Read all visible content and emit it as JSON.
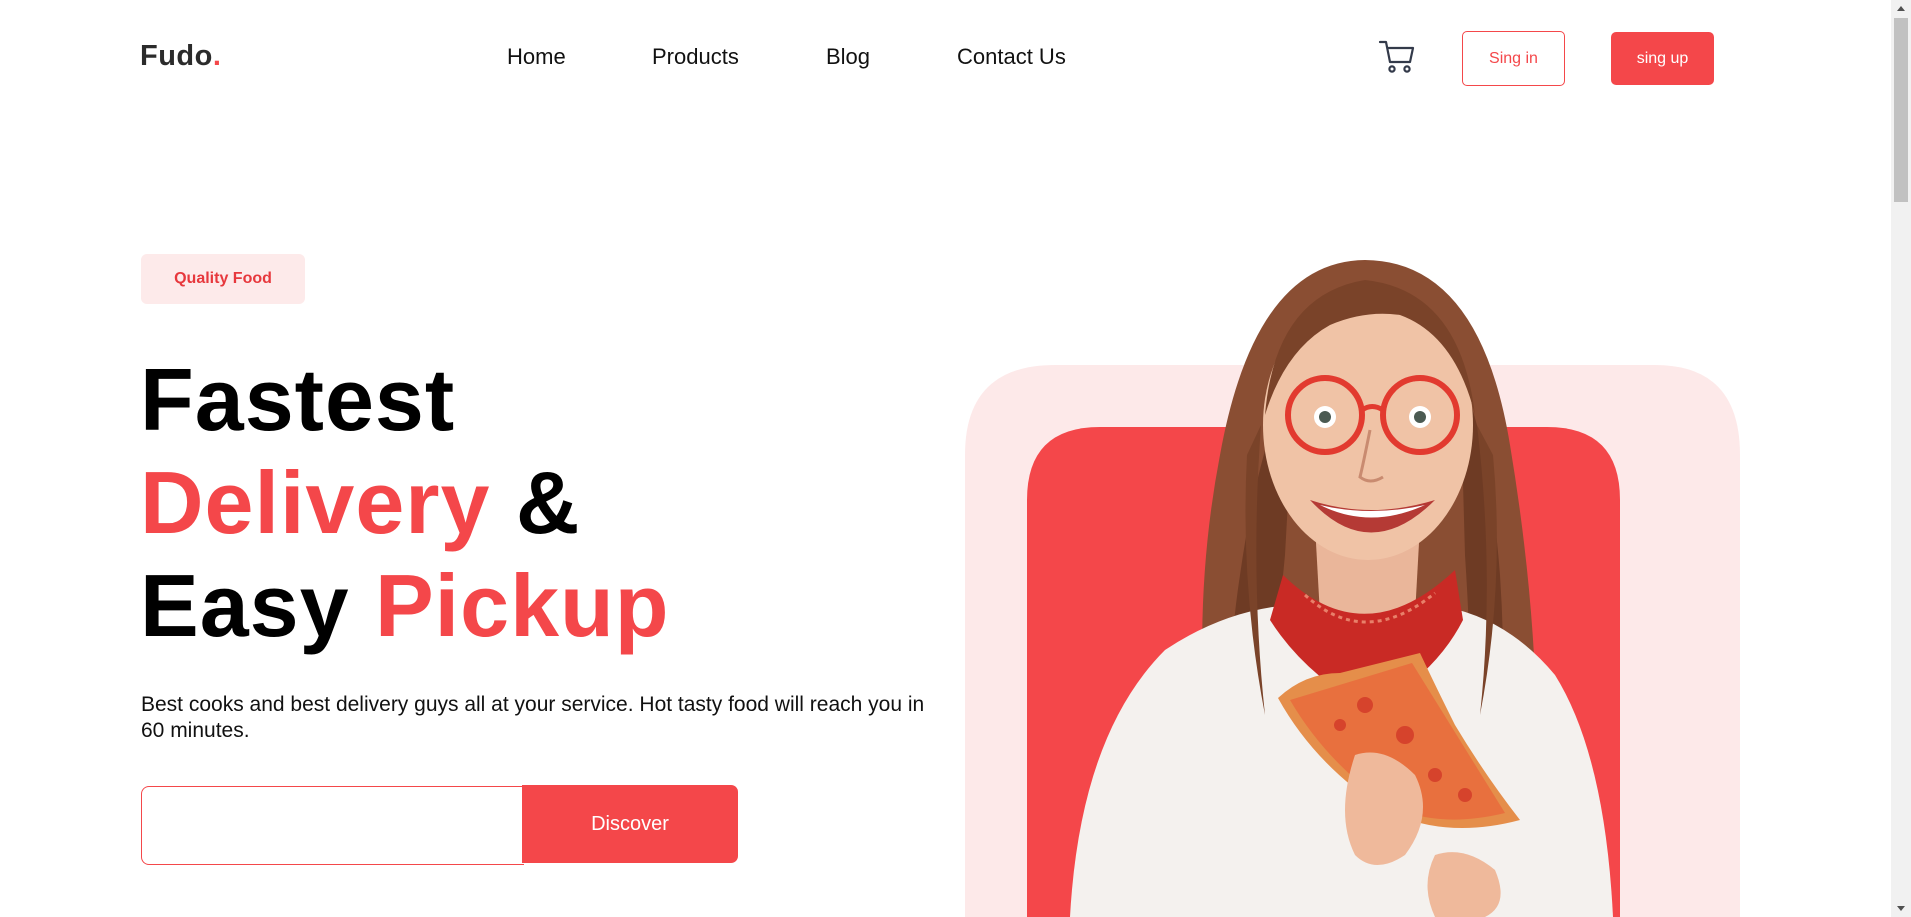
{
  "header": {
    "logo_text": "Fudo",
    "logo_dot": ".",
    "nav": [
      {
        "label": "Home"
      },
      {
        "label": "Products"
      },
      {
        "label": "Blog"
      },
      {
        "label": "Contact Us"
      }
    ],
    "cart_icon": "shopping-cart-icon",
    "signin_label": "Sing in",
    "signup_label": "sing up"
  },
  "hero": {
    "badge": "Quality Food",
    "headline": {
      "line1": "Fastest",
      "line2_accent": "Delivery",
      "line2_rest": "&",
      "line3_start": "Easy",
      "line3_accent": "Pickup"
    },
    "description": "Best cooks and best delivery guys all at your service. Hot tasty food will reach you in 60 minutes.",
    "email_placeholder": "",
    "discover_label": "Discover"
  },
  "colors": {
    "accent": "#f4474a",
    "accent_light": "#fdeaea",
    "text": "#111111"
  }
}
